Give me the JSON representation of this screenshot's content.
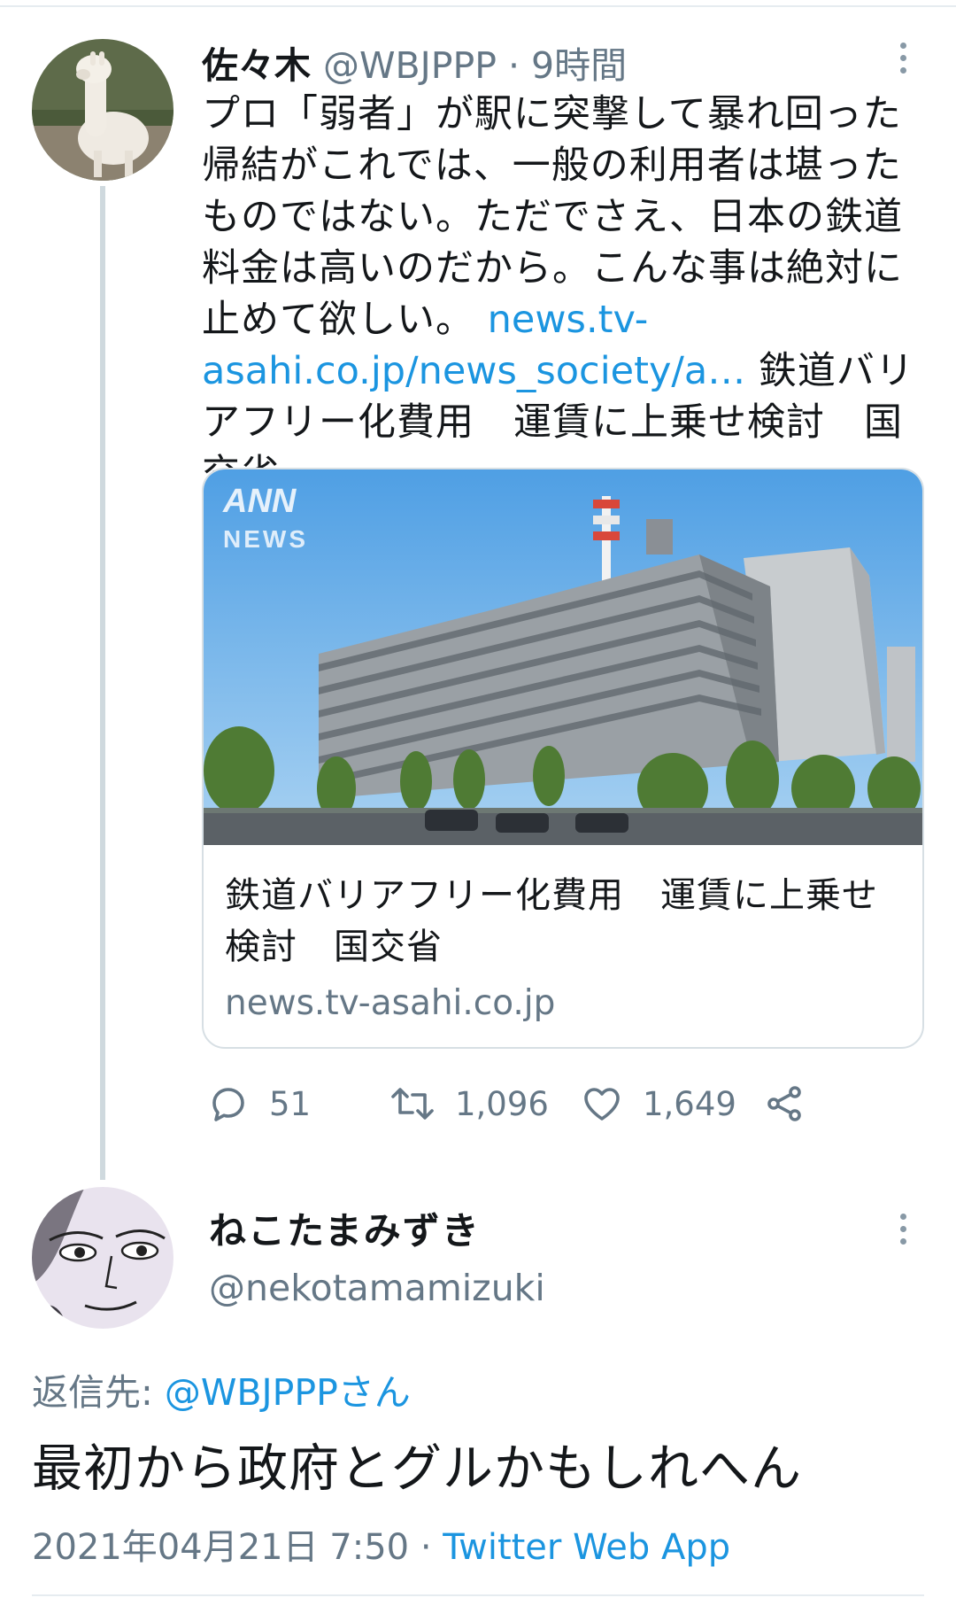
{
  "tweet1": {
    "display_name": "佐々木",
    "handle_time": "@WBJPPP · 9時間",
    "text": "プロ「弱者」が駅に突撃して暴れ回った帰結がこれでは、一般の利用者は堪ったものではない。ただでさえ、日本の鉄道料金は高いのだから。こんな事は絶対に止めて欲しい。",
    "link_text": "news.tv-asahi.co.jp/news_society/a…",
    "inline_title": "鉄道バリアフリー化費用　運賃に上乗せ検討　国交省",
    "card": {
      "image_logo": "ANN",
      "image_logo_sub": "NEWS",
      "title": "鉄道バリアフリー化費用　運賃に上乗せ検討　国交省",
      "domain": "news.tv-asahi.co.jp"
    },
    "actions": {
      "reply_count": "51",
      "retweet_count": "1,096",
      "like_count": "1,649"
    }
  },
  "tweet2": {
    "display_name": "ねこたまみずき",
    "handle": "@nekotamamizuki",
    "reply_prefix": "返信先: ",
    "reply_mention": "@WBJPPPさん",
    "text": "最初から政府とグルかもしれへん",
    "timestamp": "2021年04月21日 7:50",
    "separator": " · ",
    "app": "Twitter Web App"
  },
  "colors": {
    "link": "#1b95e0",
    "secondary_text": "#657786",
    "primary_text": "#14171a",
    "thread_line": "#cfd9de"
  },
  "icons": [
    "more-vertical-icon",
    "reply-icon",
    "retweet-icon",
    "like-icon",
    "share-icon"
  ]
}
